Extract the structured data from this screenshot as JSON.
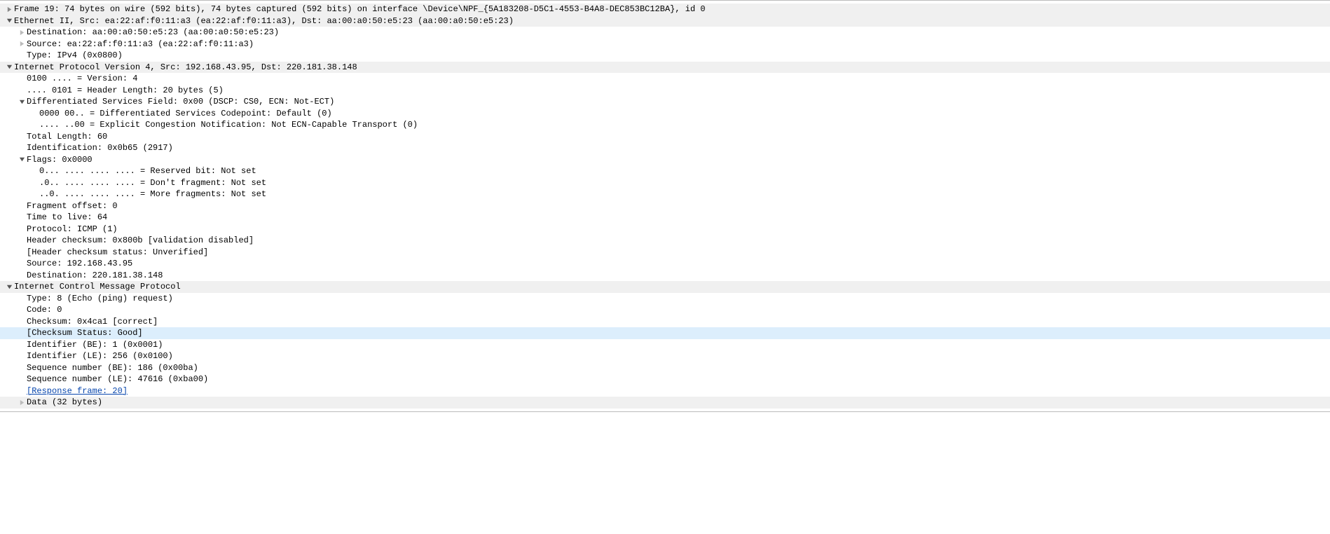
{
  "frame": {
    "summary": "Frame 19: 74 bytes on wire (592 bits), 74 bytes captured (592 bits) on interface \\Device\\NPF_{5A183208-D5C1-4553-B4A8-DEC853BC12BA}, id 0"
  },
  "eth": {
    "summary": "Ethernet II, Src: ea:22:af:f0:11:a3 (ea:22:af:f0:11:a3), Dst: aa:00:a0:50:e5:23 (aa:00:a0:50:e5:23)",
    "dst": "Destination: aa:00:a0:50:e5:23 (aa:00:a0:50:e5:23)",
    "src": "Source: ea:22:af:f0:11:a3 (ea:22:af:f0:11:a3)",
    "type": "Type: IPv4 (0x0800)"
  },
  "ip": {
    "summary": "Internet Protocol Version 4, Src: 192.168.43.95, Dst: 220.181.38.148",
    "version": "0100 .... = Version: 4",
    "hlen": ".... 0101 = Header Length: 20 bytes (5)",
    "dsf": {
      "summary": "Differentiated Services Field: 0x00 (DSCP: CS0, ECN: Not-ECT)",
      "dscp": "0000 00.. = Differentiated Services Codepoint: Default (0)",
      "ecn": ".... ..00 = Explicit Congestion Notification: Not ECN-Capable Transport (0)"
    },
    "tlen": "Total Length: 60",
    "id": "Identification: 0x0b65 (2917)",
    "flags": {
      "summary": "Flags: 0x0000",
      "reserved": "0... .... .... .... = Reserved bit: Not set",
      "df": ".0.. .... .... .... = Don't fragment: Not set",
      "mf": "..0. .... .... .... = More fragments: Not set"
    },
    "fragoff": "Fragment offset: 0",
    "ttl": "Time to live: 64",
    "proto": "Protocol: ICMP (1)",
    "hchk": "Header checksum: 0x800b [validation disabled]",
    "hchkstat": "[Header checksum status: Unverified]",
    "src": "Source: 192.168.43.95",
    "dst": "Destination: 220.181.38.148"
  },
  "icmp": {
    "summary": "Internet Control Message Protocol",
    "type": "Type: 8 (Echo (ping) request)",
    "code": "Code: 0",
    "chk": "Checksum: 0x4ca1 [correct]",
    "chkstat": "[Checksum Status: Good]",
    "idbe": "Identifier (BE): 1 (0x0001)",
    "idle": "Identifier (LE): 256 (0x0100)",
    "seqbe": "Sequence number (BE): 186 (0x00ba)",
    "seqle": "Sequence number (LE): 47616 (0xba00)",
    "resp": "[Response frame: 20]",
    "data": "Data (32 bytes)"
  }
}
